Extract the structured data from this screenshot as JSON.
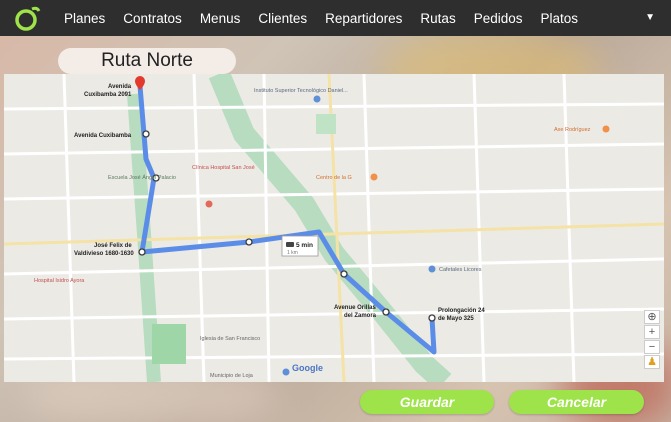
{
  "nav": {
    "items": [
      "Planes",
      "Contratos",
      "Menus",
      "Clientes",
      "Repartidores",
      "Rutas",
      "Pedidos",
      "Platos"
    ],
    "caret": "▼"
  },
  "page": {
    "title": "Ruta Norte"
  },
  "map": {
    "stops": [
      {
        "label_line1": "Avenida",
        "label_line2": "Cuxibamba 2091"
      },
      {
        "label_line1": "Avenida Cuxibamba",
        "label_line2": ""
      },
      {
        "label_line1": "José Felix de",
        "label_line2": "Valdivieso 1680-1630"
      },
      {
        "label_line1": "Avenue Orillas",
        "label_line2": "del Zamora"
      },
      {
        "label_line1": "Prolongación 24",
        "label_line2": "de Mayo 325"
      }
    ],
    "travel_badge": "5 min",
    "travel_badge_sub": "1 km",
    "pois": [
      {
        "name": "Instituto Superior Tecnológico Daniel..."
      },
      {
        "name": "Escuela José Ángel Palacio"
      },
      {
        "name": "Clínica Hospital San José"
      },
      {
        "name": "Centro de la G"
      },
      {
        "name": "Axe Rodríguez"
      },
      {
        "name": "Cafetales Licores"
      },
      {
        "name": "Hospital Isidro Ayora"
      },
      {
        "name": "Iglesia de San Francisco"
      },
      {
        "name": "Municipio de Loja"
      }
    ],
    "attribution": "Google",
    "zoom_in": "+",
    "zoom_out": "−",
    "locate": "⊕",
    "pegman": "♟",
    "route_color": "#5b8de8"
  },
  "actions": {
    "save_label": "Guardar",
    "cancel_label": "Cancelar"
  },
  "colors": {
    "accent": "#9ee34a",
    "navbar": "#2e2e2e"
  }
}
